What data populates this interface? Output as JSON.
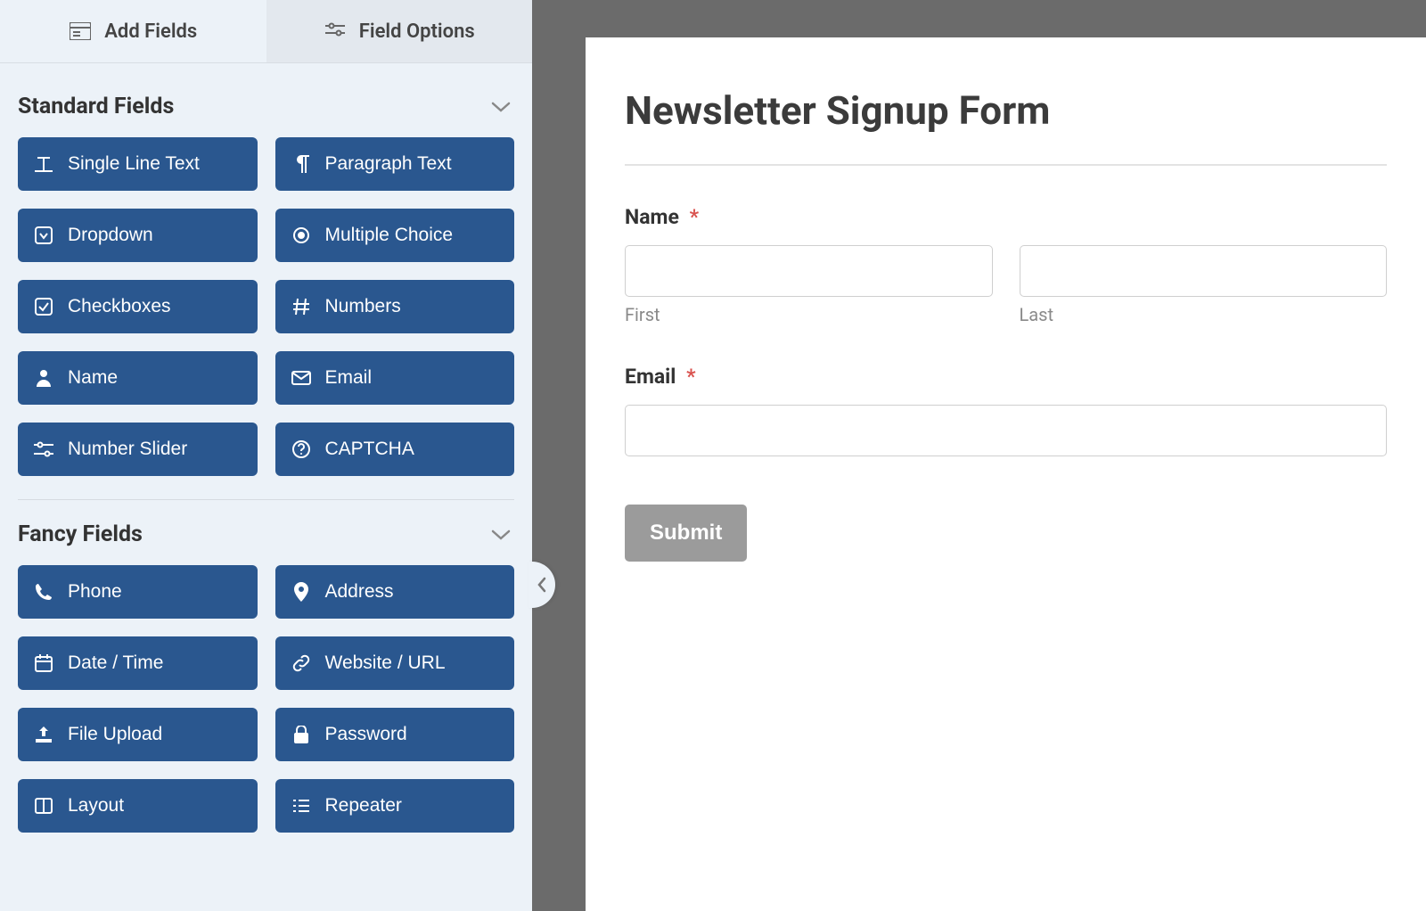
{
  "tabs": {
    "add_fields": "Add Fields",
    "field_options": "Field Options"
  },
  "sections": {
    "standard": {
      "title": "Standard Fields",
      "fields": [
        {
          "icon": "text-icon",
          "label": "Single Line Text"
        },
        {
          "icon": "paragraph-icon",
          "label": "Paragraph Text"
        },
        {
          "icon": "dropdown-icon",
          "label": "Dropdown"
        },
        {
          "icon": "radio-icon",
          "label": "Multiple Choice"
        },
        {
          "icon": "checkbox-icon",
          "label": "Checkboxes"
        },
        {
          "icon": "hash-icon",
          "label": "Numbers"
        },
        {
          "icon": "user-icon",
          "label": "Name"
        },
        {
          "icon": "envelope-icon",
          "label": "Email"
        },
        {
          "icon": "sliders-icon",
          "label": "Number Slider"
        },
        {
          "icon": "question-icon",
          "label": "CAPTCHA"
        }
      ]
    },
    "fancy": {
      "title": "Fancy Fields",
      "fields": [
        {
          "icon": "phone-icon",
          "label": "Phone"
        },
        {
          "icon": "pin-icon",
          "label": "Address"
        },
        {
          "icon": "calendar-icon",
          "label": "Date / Time"
        },
        {
          "icon": "link-icon",
          "label": "Website / URL"
        },
        {
          "icon": "upload-icon",
          "label": "File Upload"
        },
        {
          "icon": "lock-icon",
          "label": "Password"
        },
        {
          "icon": "columns-icon",
          "label": "Layout"
        },
        {
          "icon": "list-icon",
          "label": "Repeater"
        }
      ]
    }
  },
  "preview": {
    "title": "Newsletter Signup Form",
    "name_label": "Name",
    "first_sub": "First",
    "last_sub": "Last",
    "email_label": "Email",
    "submit": "Submit",
    "required_mark": "*"
  }
}
